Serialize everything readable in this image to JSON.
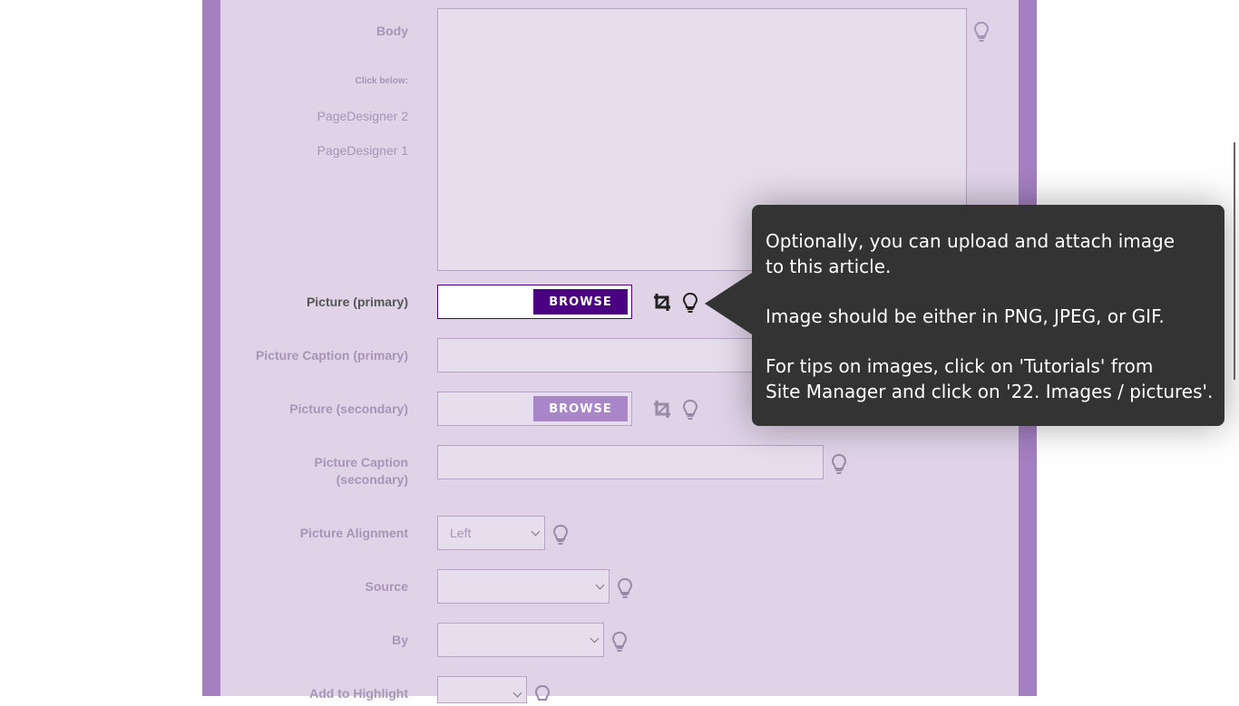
{
  "form": {
    "body_label": "Body",
    "click_below": "Click below:",
    "page_designer_2": "PageDesigner 2",
    "page_designer_1": "PageDesigner 1",
    "picture_primary_label": "Picture (primary)",
    "picture_caption_primary_label": "Picture Caption (primary)",
    "picture_secondary_label": "Picture (secondary)",
    "picture_caption_secondary_label_1": "Picture Caption",
    "picture_caption_secondary_label_2": "(secondary)",
    "picture_alignment_label": "Picture Alignment",
    "picture_alignment_value": "Left",
    "source_label": "Source",
    "source_value": "",
    "by_label": "By",
    "by_value": "",
    "add_to_highlight_label": "Add to Highlight",
    "browse_label": "BROWSE"
  },
  "tooltip": {
    "line1": "Optionally, you can upload and attach image",
    "line2": "to this article.",
    "line3": "Image should be either in PNG, JPEG, or GIF.",
    "line4": "For tips on images, click on 'Tutorials' from",
    "line5": "Site Manager and click on '22. Images / pictures'."
  },
  "colors": {
    "frame": "#a47fc1",
    "panel": "#e0d3e8",
    "browse_active": "#4b0082",
    "browse_inactive": "#a886c8",
    "tooltip_bg": "#333333"
  },
  "icons": [
    "lightbulb-icon",
    "crop-icon",
    "chevron-down-icon"
  ]
}
